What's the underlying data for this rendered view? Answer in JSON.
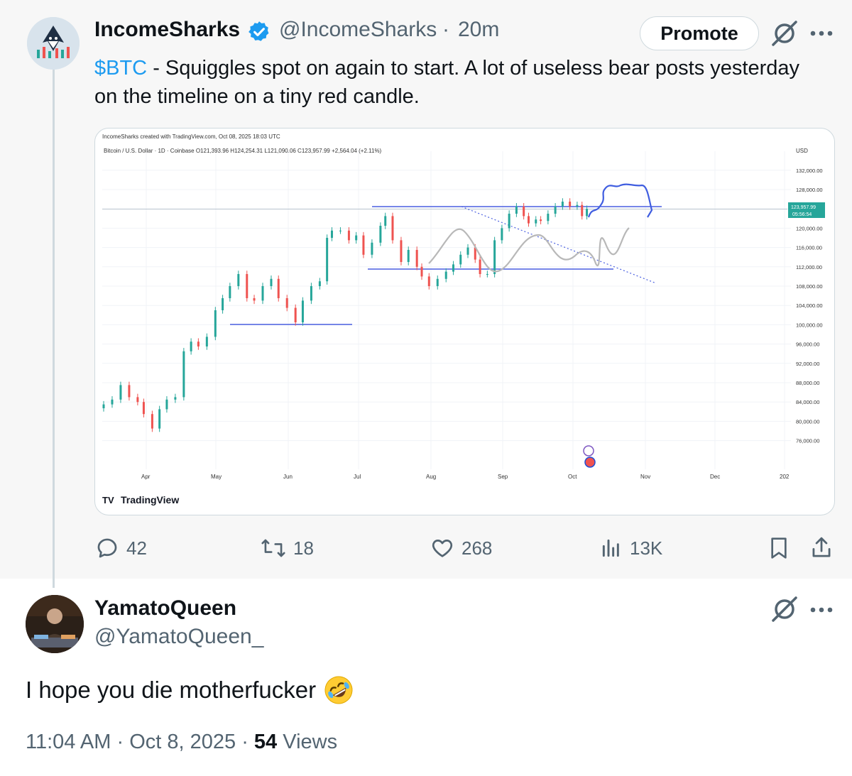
{
  "post": {
    "display_name": "IncomeSharks",
    "handle": "@IncomeSharks",
    "separator": "·",
    "time": "20m",
    "promote_label": "Promote",
    "cashtag": "$BTC",
    "text": " - Squiggles spot on again to start. A lot of useless bear posts yesterday on the timeline on a tiny red candle.",
    "actions": {
      "replies": "42",
      "reposts": "18",
      "likes": "268",
      "views": "13K"
    }
  },
  "chart_card": {
    "header": "IncomeSharks created with TradingView.com, Oct 08, 2025 18:03 UTC",
    "symbol_line": "Bitcoin / U.S. Dollar · 1D · Coinbase  O121,393.96  H124,254.31  L121,090.06  C123,957.99  +2,564.04 (+2.11%)",
    "branding": "TradingView",
    "currency": "USD",
    "price_tag": "123,957.99",
    "countdown": "05:56:54"
  },
  "chart_data": {
    "type": "line",
    "title": "Bitcoin / U.S. Dollar · 1D · Coinbase",
    "xlabel": "",
    "ylabel": "USD",
    "x_tick_labels": [
      "Apr",
      "May",
      "Jun",
      "Jul",
      "Aug",
      "Sep",
      "Oct",
      "Nov",
      "Dec",
      "202"
    ],
    "y_tick_labels": [
      "132,000.00",
      "128,000.00",
      "124,000.00",
      "120,000.00",
      "116,000.00",
      "112,000.00",
      "108,000.00",
      "104,000.00",
      "100,000.00",
      "96,000.00",
      "92,000.00",
      "88,000.00",
      "84,000.00",
      "80,000.00",
      "76,000.00"
    ],
    "ylim": [
      73000,
      133000
    ],
    "series": [
      {
        "color": "#26a69a",
        "x": [
          0,
          7,
          14,
          21,
          28,
          33,
          40,
          46,
          52,
          59,
          66,
          72,
          78,
          85,
          92,
          98,
          104,
          111,
          118,
          124,
          131,
          138,
          144,
          151,
          158,
          164,
          171,
          178,
          184,
          188,
          195,
          202,
          208,
          214,
          221,
          228,
          232,
          238,
          245,
          251,
          258,
          262,
          268,
          275,
          282,
          288,
          294,
          300,
          306,
          310,
          316,
          322,
          328,
          334,
          340,
          346,
          350,
          356,
          360,
          366,
          372,
          378,
          384,
          390,
          394,
          398
        ],
        "values": [
          83500,
          84500,
          87500,
          85000,
          84000,
          81500,
          78500,
          82500,
          84500,
          85000,
          94500,
          96500,
          95500,
          97500,
          103000,
          105500,
          108000,
          110500,
          105500,
          105000,
          108000,
          109500,
          105500,
          103500,
          100500,
          105000,
          108000,
          109000,
          118000,
          119500,
          119500,
          117500,
          118500,
          114500,
          117000,
          120500,
          122500,
          117500,
          113000,
          115500,
          112000,
          110000,
          108000,
          109500,
          111000,
          112500,
          114500,
          116000,
          113500,
          110500,
          110500,
          117500,
          120000,
          123000,
          124500,
          122500,
          121000,
          121800,
          121500,
          123000,
          124500,
          125500,
          124500,
          124800,
          122500,
          124000
        ]
      }
    ],
    "annotations": [
      "horizontal levels at 123,957.99, 112,000 and 101,200",
      "descending dotted trendline",
      "grey and blue projection squiggles"
    ]
  },
  "reply": {
    "display_name": "YamatoQueen",
    "handle": "@YamatoQueen_",
    "text": "I hope you die motherfucker",
    "emoji": "rolling-on-floor-laughing-emoji",
    "meta_time": "11:04 AM",
    "meta_sep1": "·",
    "meta_date": "Oct 8, 2025",
    "meta_sep2": "·",
    "views_count": "54",
    "views_label": "Views"
  },
  "colors": {
    "accent": "#1d9bf0",
    "bull": "#26a69a",
    "bear": "#ef5350",
    "level_line": "#4a5fe0",
    "projection_grey": "#b8b8b8",
    "projection_blue": "#3f5de0"
  }
}
